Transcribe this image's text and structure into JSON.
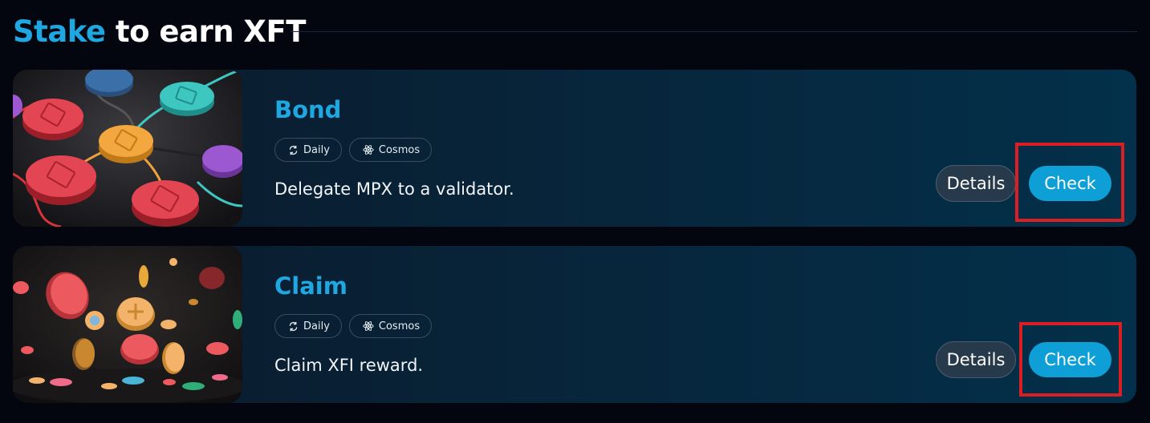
{
  "section": {
    "title_accent": "Stake",
    "title_rest": " to earn XFT"
  },
  "tasks": [
    {
      "title": "Bond",
      "tags": [
        {
          "label": "Daily",
          "icon": "refresh-icon"
        },
        {
          "label": "Cosmos",
          "icon": "cosmos-atom-icon"
        }
      ],
      "description": "Delegate MPX to a validator.",
      "details_label": "Details",
      "check_label": "Check",
      "thumbnail": "network-nodes-image"
    },
    {
      "title": "Claim",
      "tags": [
        {
          "label": "Daily",
          "icon": "refresh-icon"
        },
        {
          "label": "Cosmos",
          "icon": "cosmos-atom-icon"
        }
      ],
      "description": "Claim XFI reward.",
      "details_label": "Details",
      "check_label": "Check",
      "thumbnail": "falling-coins-image"
    }
  ],
  "colors": {
    "background": "#03050f",
    "accent": "#1ea7e0",
    "check_button": "#0e9fd6",
    "details_button": "#273a4b",
    "highlight_box": "#d91f22"
  }
}
